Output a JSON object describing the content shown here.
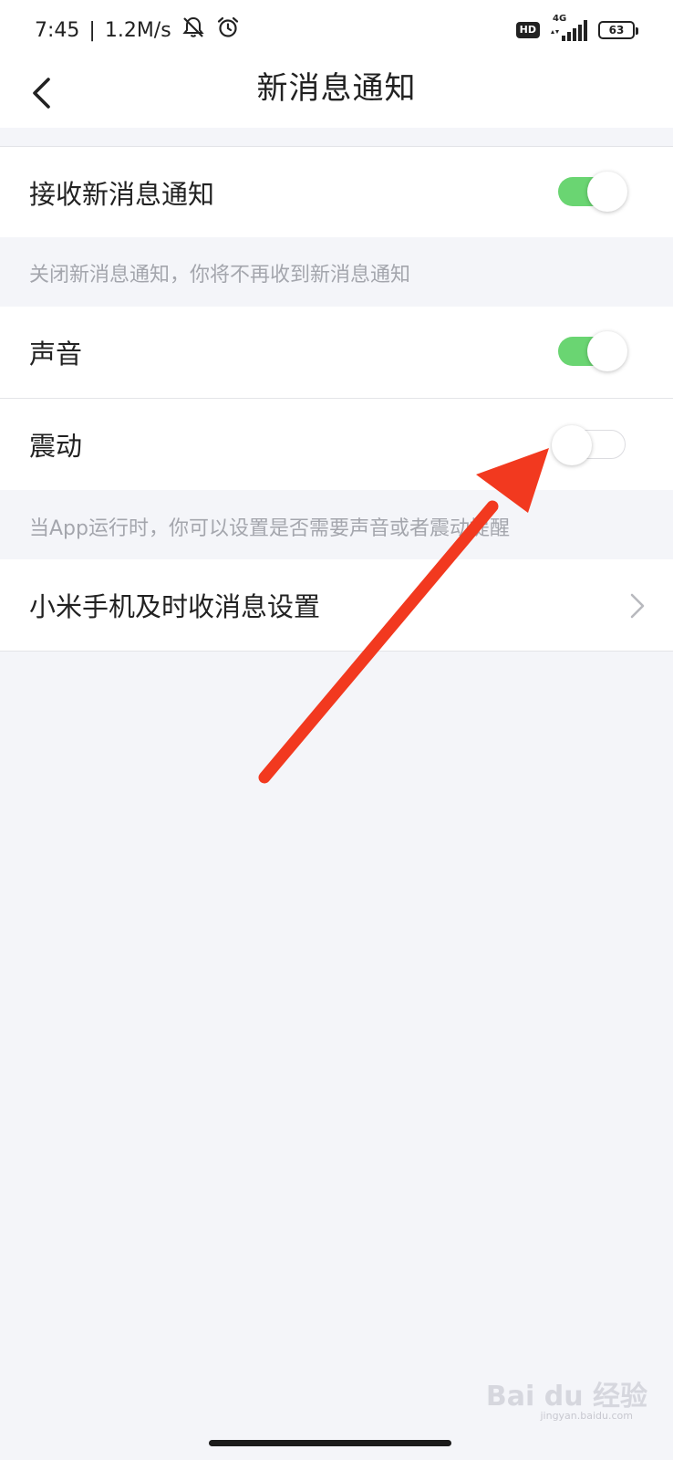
{
  "status_bar": {
    "time": "7:45",
    "separator": "|",
    "speed": "1.2M/s",
    "hd": "HD",
    "network": "4G",
    "battery": "63"
  },
  "nav": {
    "title": "新消息通知"
  },
  "settings": {
    "receive_label": "接收新消息通知",
    "receive_on": true,
    "receive_hint": "关闭新消息通知，你将不再收到新消息通知",
    "sound_label": "声音",
    "sound_on": true,
    "vibrate_label": "震动",
    "vibrate_on": false,
    "app_hint": "当App运行时，你可以设置是否需要声音或者震动提醒",
    "xiaomi_label": "小米手机及时收消息设置"
  },
  "watermark": {
    "brand": "Bai du 经验",
    "url": "jingyan.baidu.com"
  },
  "colors": {
    "toggle_on": "#6ad572",
    "annotation_arrow": "#f2391f",
    "page_background": "#f4f5f9"
  }
}
